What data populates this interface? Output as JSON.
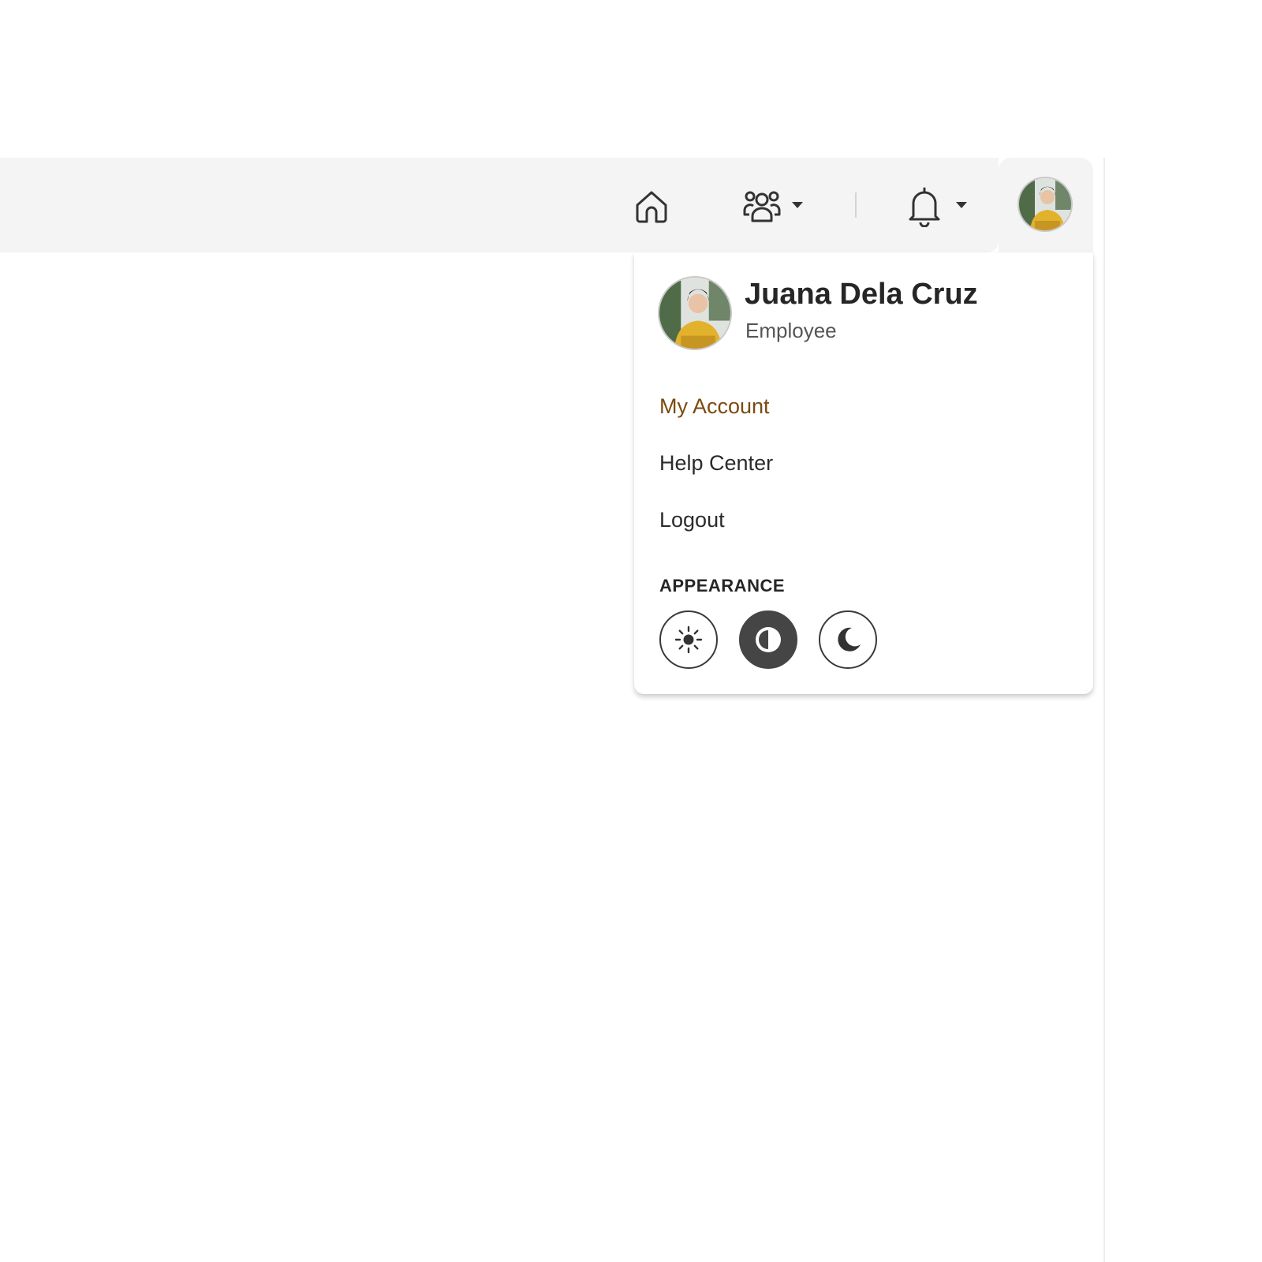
{
  "header": {
    "nav": [
      {
        "name": "home-icon"
      },
      {
        "name": "team-icon"
      },
      {
        "name": "bell-icon"
      }
    ]
  },
  "user_menu": {
    "name": "Juana Dela Cruz",
    "role": "Employee",
    "items": [
      {
        "label": "My Account",
        "active": true
      },
      {
        "label": "Help Center",
        "active": false
      },
      {
        "label": "Logout",
        "active": false
      }
    ],
    "appearance": {
      "label": "APPEARANCE",
      "options": [
        "light",
        "auto",
        "dark"
      ],
      "selected": "auto"
    }
  },
  "colors": {
    "accent_text": "#7a4a10",
    "topbar_bg": "#f4f4f4",
    "selected_theme_bg": "#454545"
  }
}
